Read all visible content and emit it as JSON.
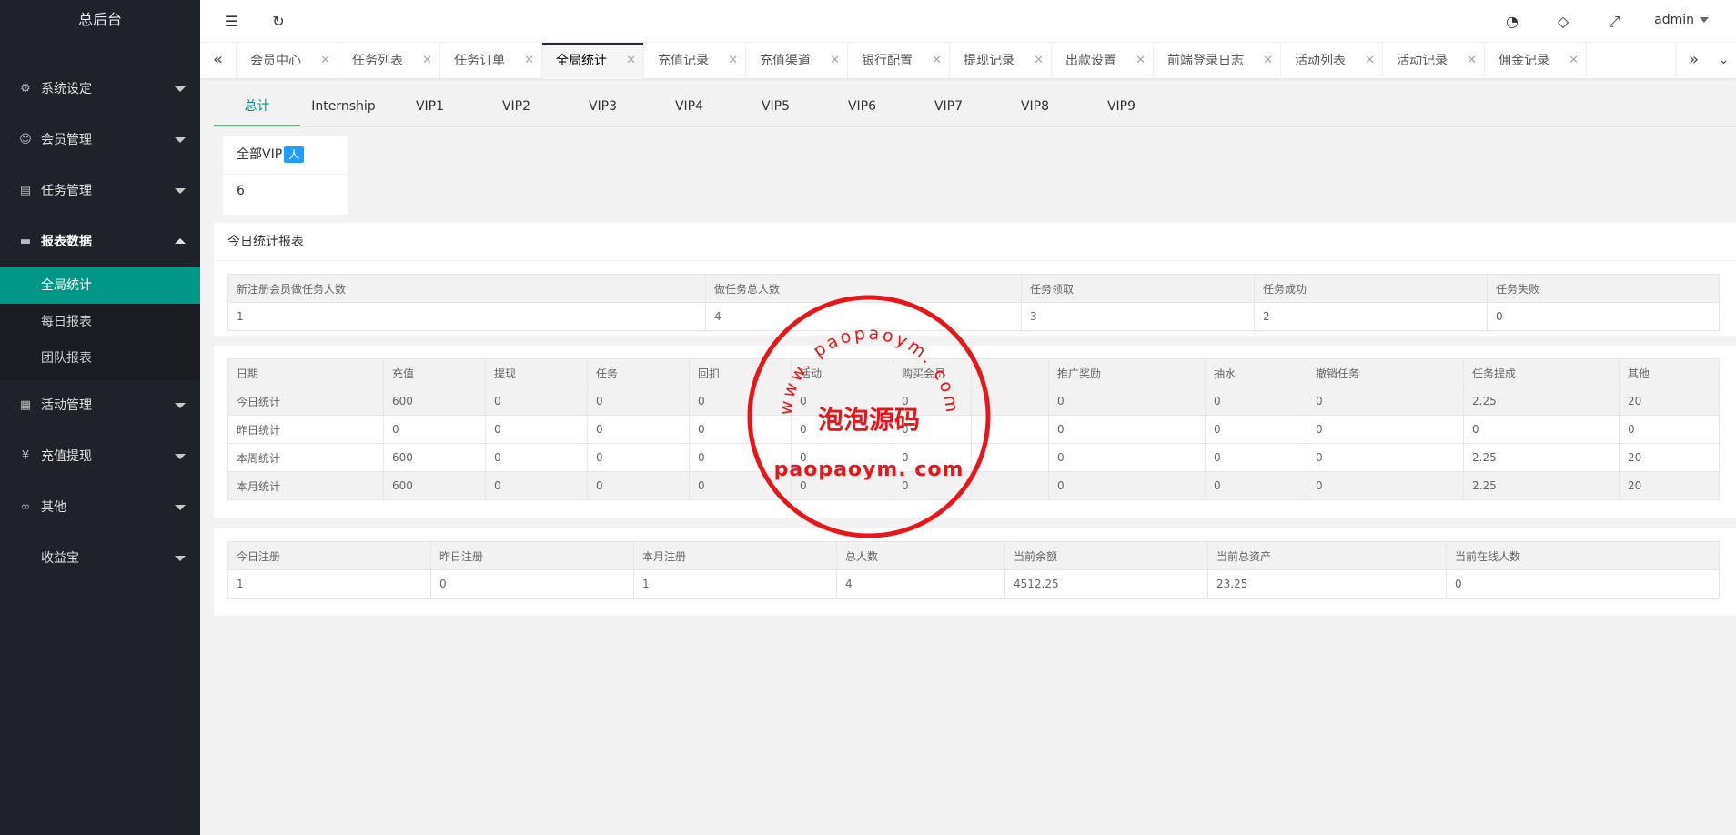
{
  "app": {
    "title": "总后台"
  },
  "sidebar": {
    "items": [
      {
        "label": "系统设定",
        "icon": "gear-icon"
      },
      {
        "label": "会员管理",
        "icon": "user-icon"
      },
      {
        "label": "任务管理",
        "icon": "document-icon"
      },
      {
        "label": "报表数据",
        "icon": "chart-icon"
      },
      {
        "label": "活动管理",
        "icon": "activity-icon"
      },
      {
        "label": "充值提现",
        "icon": "yen-icon"
      },
      {
        "label": "其他",
        "icon": "link-icon"
      },
      {
        "label": "收益宝",
        "icon": ""
      }
    ],
    "report_subitems": [
      "全局统计",
      "每日报表",
      "团队报表"
    ]
  },
  "header": {
    "user": "admin"
  },
  "tabs": [
    "会员中心",
    "任务列表",
    "任务订单",
    "全局统计",
    "充值记录",
    "充值渠道",
    "银行配置",
    "提现记录",
    "出款设置",
    "前端登录日志",
    "活动列表",
    "活动记录",
    "佣金记录"
  ],
  "vip_tabs": [
    "总计",
    "Internship",
    "VIP1",
    "VIP2",
    "VIP3",
    "VIP4",
    "VIP5",
    "VIP6",
    "VIP7",
    "VIP8",
    "VIP9"
  ],
  "vip_card": {
    "label": "全部VIP",
    "badge": "人",
    "value": "6"
  },
  "today_report": {
    "title": "今日统计报表",
    "headers": [
      "新注册会员做任务人数",
      "做任务总人数",
      "任务领取",
      "任务成功",
      "任务失败"
    ],
    "row": [
      "1",
      "4",
      "3",
      "2",
      "0"
    ]
  },
  "finance_table": {
    "headers": [
      "日期",
      "充值",
      "提现",
      "任务",
      "回扣",
      "活动",
      "购买会员",
      "",
      "推广奖励",
      "抽水",
      "撤销任务",
      "任务提成",
      "其他"
    ],
    "rows": [
      [
        "今日统计",
        "600",
        "0",
        "0",
        "0",
        "0",
        "0",
        "",
        "0",
        "0",
        "0",
        "2.25",
        "20"
      ],
      [
        "昨日统计",
        "0",
        "0",
        "0",
        "0",
        "0",
        "0",
        "",
        "0",
        "0",
        "0",
        "0",
        "0"
      ],
      [
        "本周统计",
        "600",
        "0",
        "0",
        "0",
        "0",
        "0",
        "",
        "0",
        "0",
        "0",
        "2.25",
        "20"
      ],
      [
        "本月统计",
        "600",
        "0",
        "0",
        "0",
        "0",
        "0",
        "",
        "0",
        "0",
        "0",
        "2.25",
        "20"
      ]
    ]
  },
  "register_table": {
    "headers": [
      "今日注册",
      "昨日注册",
      "本月注册",
      "总人数",
      "当前余额",
      "当前总资产",
      "当前在线人数"
    ],
    "row": [
      "1",
      "0",
      "1",
      "4",
      "4512.25",
      "23.25",
      "0"
    ]
  },
  "watermark": {
    "top": "www. paopaoym. com",
    "middle": "泡泡源码",
    "bottom": "paopaoym. com"
  },
  "colors": {
    "sidebar_bg": "#20222a",
    "active_green": "#009688",
    "badge_blue": "#1e9fff",
    "stamp_red": "#e8161b"
  }
}
